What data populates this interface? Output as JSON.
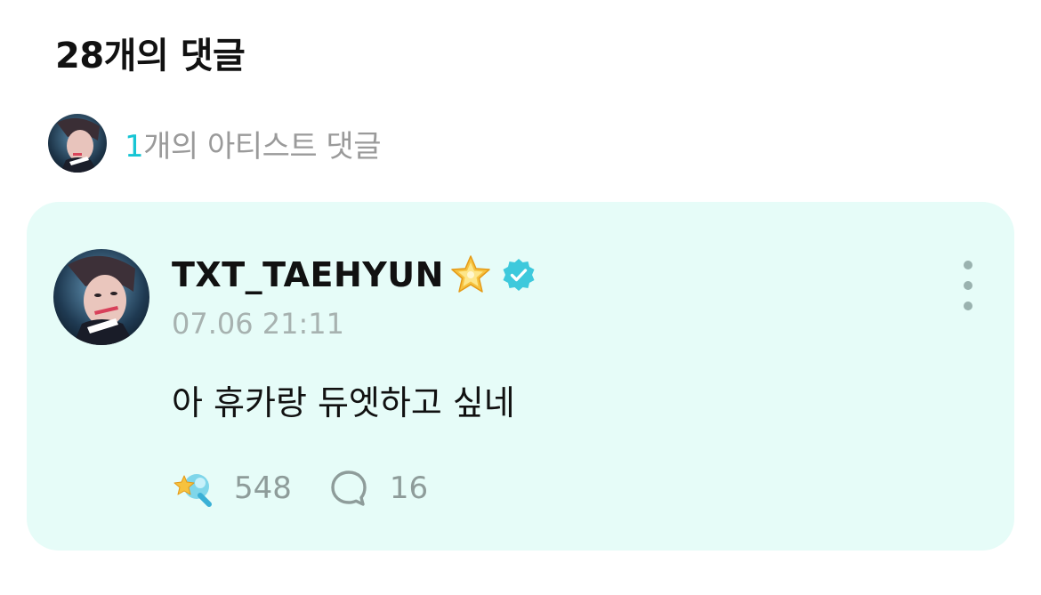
{
  "comments_section": {
    "title": "28개의 댓글"
  },
  "artist_summary": {
    "count": "1",
    "label": "개의 아티스트 댓글"
  },
  "comment": {
    "author": "TXT_TAEHYUN",
    "badges": [
      "star-emoji",
      "verified-icon"
    ],
    "timestamp": "07.06 21:11",
    "text": "아 휴카랑 듀엣하고 싶네",
    "likes": "548",
    "replies": "16",
    "more_icon": "more-vertical-icon",
    "like_icon": "lightstick-like-icon",
    "reply_icon": "speech-bubble-icon"
  },
  "colors": {
    "card_background": "#e6fcf8",
    "accent": "#17c5d4",
    "muted_text": "#9a9a9a",
    "verified": "#3ec9dc"
  }
}
